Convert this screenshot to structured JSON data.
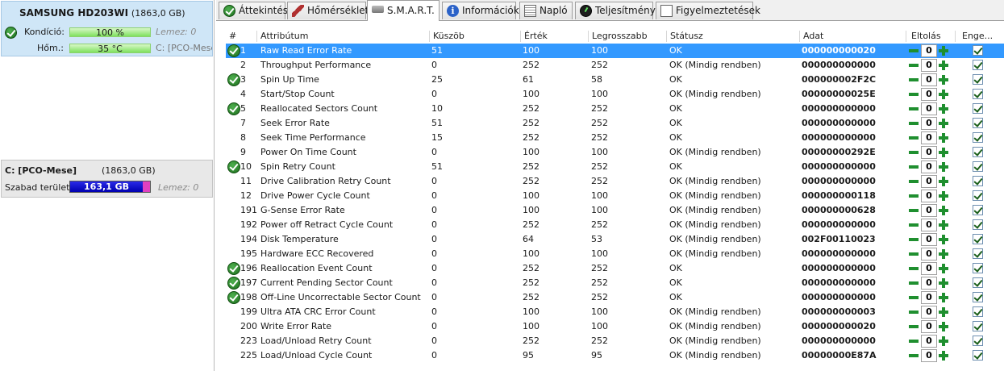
{
  "disk": {
    "name": "SAMSUNG HD203WI",
    "size": "(1863,0 GB)",
    "health_label": "Kondíció:",
    "health_value": "100 %",
    "health_pct": 100,
    "temp_label": "Hőm.:",
    "temp_value": "35 °C",
    "lemez": "Lemez: 0",
    "partition_short": "C: [PCO-Mese]"
  },
  "partition": {
    "name": "C: [PCO-Mese]",
    "size": "(1863,0 GB)",
    "free_label": "Szabad terület",
    "free_value": "163,1 GB",
    "free_fill_pct": 91,
    "lemez": "Lemez: 0"
  },
  "tabs": [
    {
      "label": "Áttekintés",
      "icon": "check-icon"
    },
    {
      "label": "Hőmérséklet",
      "icon": "thermometer-icon"
    },
    {
      "label": "S.M.A.R.T.",
      "icon": "smart-drive-icon"
    },
    {
      "label": "Információk",
      "icon": "info-icon"
    },
    {
      "label": "Napló",
      "icon": "log-icon"
    },
    {
      "label": "Teljesítmény",
      "icon": "performance-icon"
    },
    {
      "label": "Figyelmeztetések",
      "icon": "warnings-icon"
    }
  ],
  "active_tab": "S.M.A.R.T.",
  "columns": [
    "#",
    "Attribútum",
    "Küszöb",
    "Érték",
    "Legrosszabb",
    "Státusz",
    "Adat",
    "Eltolás",
    "Enge..."
  ],
  "rows": [
    {
      "id": "1",
      "attr": "Raw Read Error Rate",
      "thr": "51",
      "val": "100",
      "worst": "100",
      "status": "OK",
      "data": "000000000020",
      "offset": "0",
      "ok_icon": true
    },
    {
      "id": "2",
      "attr": "Throughput Performance",
      "thr": "0",
      "val": "252",
      "worst": "252",
      "status": "OK (Mindig rendben)",
      "data": "000000000000",
      "offset": "0",
      "ok_icon": false
    },
    {
      "id": "3",
      "attr": "Spin Up Time",
      "thr": "25",
      "val": "61",
      "worst": "58",
      "status": "OK",
      "data": "000000002F2C",
      "offset": "0",
      "ok_icon": true
    },
    {
      "id": "4",
      "attr": "Start/Stop Count",
      "thr": "0",
      "val": "100",
      "worst": "100",
      "status": "OK (Mindig rendben)",
      "data": "00000000025E",
      "offset": "0",
      "ok_icon": false
    },
    {
      "id": "5",
      "attr": "Reallocated Sectors Count",
      "thr": "10",
      "val": "252",
      "worst": "252",
      "status": "OK",
      "data": "000000000000",
      "offset": "0",
      "ok_icon": true
    },
    {
      "id": "7",
      "attr": "Seek Error Rate",
      "thr": "51",
      "val": "252",
      "worst": "252",
      "status": "OK",
      "data": "000000000000",
      "offset": "0",
      "ok_icon": false
    },
    {
      "id": "8",
      "attr": "Seek Time Performance",
      "thr": "15",
      "val": "252",
      "worst": "252",
      "status": "OK",
      "data": "000000000000",
      "offset": "0",
      "ok_icon": false
    },
    {
      "id": "9",
      "attr": "Power On Time Count",
      "thr": "0",
      "val": "100",
      "worst": "100",
      "status": "OK (Mindig rendben)",
      "data": "00000000292E",
      "offset": "0",
      "ok_icon": false
    },
    {
      "id": "10",
      "attr": "Spin Retry Count",
      "thr": "51",
      "val": "252",
      "worst": "252",
      "status": "OK",
      "data": "000000000000",
      "offset": "0",
      "ok_icon": true
    },
    {
      "id": "11",
      "attr": "Drive Calibration Retry Count",
      "thr": "0",
      "val": "252",
      "worst": "252",
      "status": "OK (Mindig rendben)",
      "data": "000000000000",
      "offset": "0",
      "ok_icon": false
    },
    {
      "id": "12",
      "attr": "Drive Power Cycle Count",
      "thr": "0",
      "val": "100",
      "worst": "100",
      "status": "OK (Mindig rendben)",
      "data": "000000000118",
      "offset": "0",
      "ok_icon": false
    },
    {
      "id": "191",
      "attr": "G-Sense Error Rate",
      "thr": "0",
      "val": "100",
      "worst": "100",
      "status": "OK (Mindig rendben)",
      "data": "000000000628",
      "offset": "0",
      "ok_icon": false
    },
    {
      "id": "192",
      "attr": "Power off Retract Cycle Count",
      "thr": "0",
      "val": "252",
      "worst": "252",
      "status": "OK (Mindig rendben)",
      "data": "000000000000",
      "offset": "0",
      "ok_icon": false
    },
    {
      "id": "194",
      "attr": "Disk Temperature",
      "thr": "0",
      "val": "64",
      "worst": "53",
      "status": "OK (Mindig rendben)",
      "data": "002F00110023",
      "offset": "0",
      "ok_icon": false
    },
    {
      "id": "195",
      "attr": "Hardware ECC Recovered",
      "thr": "0",
      "val": "100",
      "worst": "100",
      "status": "OK (Mindig rendben)",
      "data": "000000000000",
      "offset": "0",
      "ok_icon": false
    },
    {
      "id": "196",
      "attr": "Reallocation Event Count",
      "thr": "0",
      "val": "252",
      "worst": "252",
      "status": "OK",
      "data": "000000000000",
      "offset": "0",
      "ok_icon": true
    },
    {
      "id": "197",
      "attr": "Current Pending Sector Count",
      "thr": "0",
      "val": "252",
      "worst": "252",
      "status": "OK",
      "data": "000000000000",
      "offset": "0",
      "ok_icon": true
    },
    {
      "id": "198",
      "attr": "Off-Line Uncorrectable Sector Count",
      "thr": "0",
      "val": "252",
      "worst": "252",
      "status": "OK",
      "data": "000000000000",
      "offset": "0",
      "ok_icon": true
    },
    {
      "id": "199",
      "attr": "Ultra ATA CRC Error Count",
      "thr": "0",
      "val": "100",
      "worst": "100",
      "status": "OK (Mindig rendben)",
      "data": "000000000003",
      "offset": "0",
      "ok_icon": false
    },
    {
      "id": "200",
      "attr": "Write Error Rate",
      "thr": "0",
      "val": "100",
      "worst": "100",
      "status": "OK (Mindig rendben)",
      "data": "000000000020",
      "offset": "0",
      "ok_icon": false
    },
    {
      "id": "223",
      "attr": "Load/Unload Retry Count",
      "thr": "0",
      "val": "252",
      "worst": "252",
      "status": "OK (Mindig rendben)",
      "data": "000000000000",
      "offset": "0",
      "ok_icon": false
    },
    {
      "id": "225",
      "attr": "Load/Unload Cycle Count",
      "thr": "0",
      "val": "95",
      "worst": "95",
      "status": "OK (Mindig rendben)",
      "data": "00000000E87A",
      "offset": "0",
      "ok_icon": false
    }
  ],
  "selected_row": 0
}
